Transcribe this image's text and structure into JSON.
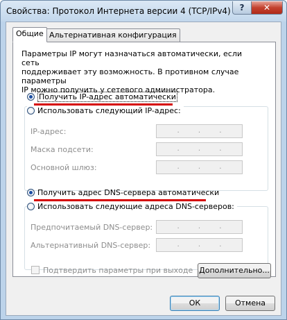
{
  "window": {
    "title": "Свойства: Протокол Интернета версии 4 (TCP/IPv4)",
    "help_glyph": "?",
    "close_glyph": "✕"
  },
  "tabs": [
    {
      "label": "Общие",
      "active": true
    },
    {
      "label": "Альтернативная конфигурация",
      "active": false
    }
  ],
  "general": {
    "intro": "Параметры IP могут назначаться автоматически, если сеть\nподдерживает эту возможность. В противном случае параметры\nIP можно получить у сетевого администратора.",
    "ip_auto_label": "Получить IP-адрес автоматически",
    "ip_manual_label": "Использовать следующий IP-адрес:",
    "ip_fields": [
      {
        "label": "IP-адрес:"
      },
      {
        "label": "Маска подсети:"
      },
      {
        "label": "Основной шлюз:"
      }
    ],
    "dns_auto_label": "Получить адрес DNS-сервера автоматически",
    "dns_manual_label": "Использовать следующие адреса DNS-серверов:",
    "dns_fields": [
      {
        "label": "Предпочитаемый DNS-сервер:"
      },
      {
        "label": "Альтернативный DNS-сервер:"
      }
    ],
    "validate_label": "Подтвердить параметры при выходе",
    "advanced_button": "Дополнительно..."
  },
  "footer": {
    "ok": "ОК",
    "cancel": "Отмена"
  },
  "colors": {
    "highlight_underline": "#d50000",
    "window_frame": "#bcd3ea"
  }
}
